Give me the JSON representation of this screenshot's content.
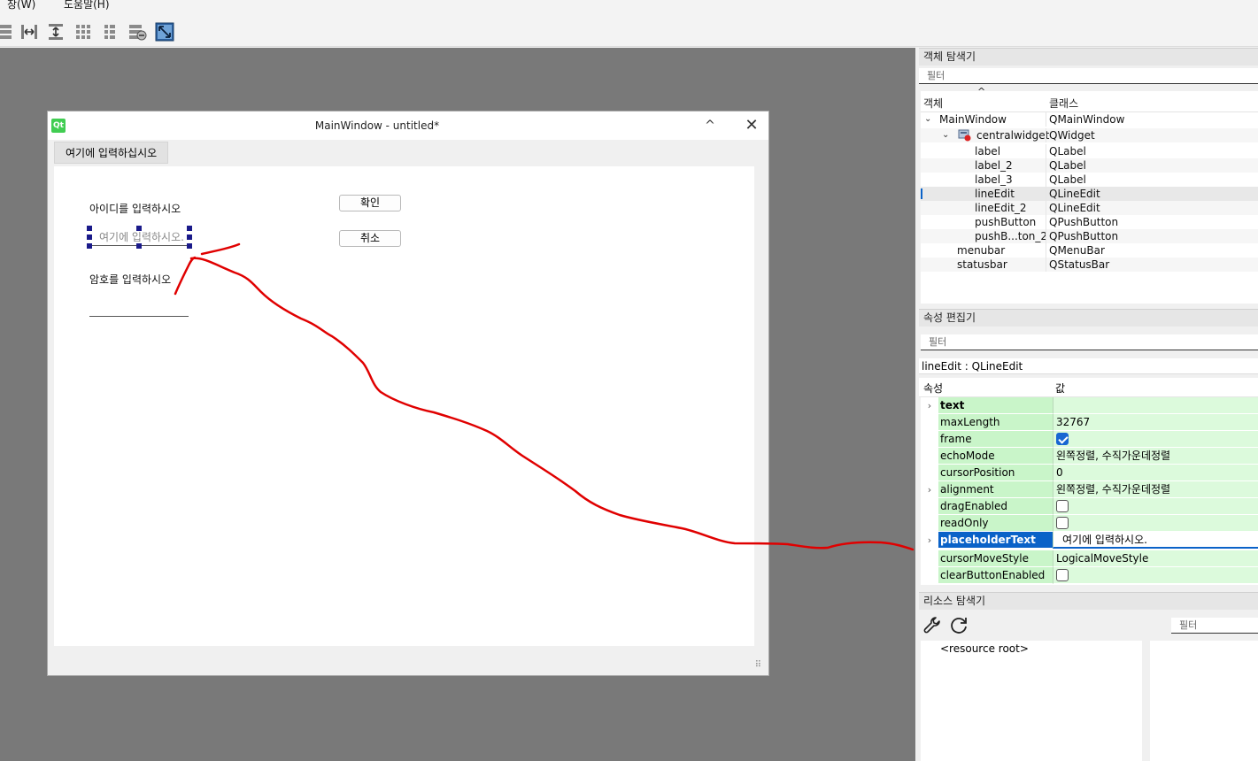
{
  "menubar": {
    "items": [
      "창(W)",
      "도움말(H)"
    ]
  },
  "toolbar": {
    "icons": [
      "layout-vertical-icon",
      "layout-h-splitter-icon",
      "layout-v-splitter-icon",
      "layout-grid-icon",
      "layout-form-icon",
      "break-layout-icon",
      "adjust-size-icon"
    ]
  },
  "form_window": {
    "title": "MainWindow - untitled*",
    "logo": "Qt",
    "minimize_glyph": "^",
    "close_glyph": "✕",
    "menu_placeholder": "여기에 입력하십시오",
    "id_label": "아이디를 입력하시오",
    "id_placeholder": "여기에 입력하시오.",
    "pw_label": "암호를 입력하시오",
    "ok_button": "확인",
    "cancel_button": "취소",
    "size_grip": "⠿"
  },
  "object_inspector": {
    "title": "객체 탐색기",
    "filter_placeholder": "필터",
    "sort_arrow": "^",
    "col_object": "객체",
    "col_class": "클래스",
    "rows": [
      {
        "name": "MainWindow",
        "class": "QMainWindow"
      },
      {
        "name": "centralwidget",
        "class": "QWidget"
      },
      {
        "name": "label",
        "class": "QLabel"
      },
      {
        "name": "label_2",
        "class": "QLabel"
      },
      {
        "name": "label_3",
        "class": "QLabel"
      },
      {
        "name": "lineEdit",
        "class": "QLineEdit"
      },
      {
        "name": "lineEdit_2",
        "class": "QLineEdit"
      },
      {
        "name": "pushButton",
        "class": "QPushButton"
      },
      {
        "name": "pushB...ton_2",
        "class": "QPushButton"
      },
      {
        "name": "menubar",
        "class": "QMenuBar"
      },
      {
        "name": "statusbar",
        "class": "QStatusBar"
      }
    ]
  },
  "property_editor": {
    "title": "속성 편집기",
    "filter_placeholder": "필터",
    "object_class": "lineEdit : QLineEdit",
    "col_property": "속성",
    "col_value": "값",
    "rows": [
      {
        "name": "text",
        "value": ""
      },
      {
        "name": "maxLength",
        "value": "32767"
      },
      {
        "name": "frame",
        "value": ""
      },
      {
        "name": "echoMode",
        "value": "왼쪽정렬, 수직가운데정렬"
      },
      {
        "name": "cursorPosition",
        "value": "0"
      },
      {
        "name": "alignment",
        "value": "왼쪽정렬, 수직가운데정렬"
      },
      {
        "name": "dragEnabled",
        "value": ""
      },
      {
        "name": "readOnly",
        "value": ""
      },
      {
        "name": "placeholderText",
        "value": "여기에 입력하시오."
      },
      {
        "name": "cursorMoveStyle",
        "value": "LogicalMoveStyle"
      },
      {
        "name": "clearButtonEnabled",
        "value": ""
      }
    ],
    "checkboxes": {
      "frame": true,
      "dragEnabled": false,
      "readOnly": false,
      "clearButtonEnabled": false
    }
  },
  "resource_browser": {
    "title": "리소스 탐색기",
    "filter_placeholder": "필터",
    "root_label": "<resource root>"
  },
  "colors": {
    "workspace": "#797979",
    "property_green": "#c9f5c9",
    "selection_blue": "#0a62c8",
    "annotation_red": "#e00000"
  }
}
